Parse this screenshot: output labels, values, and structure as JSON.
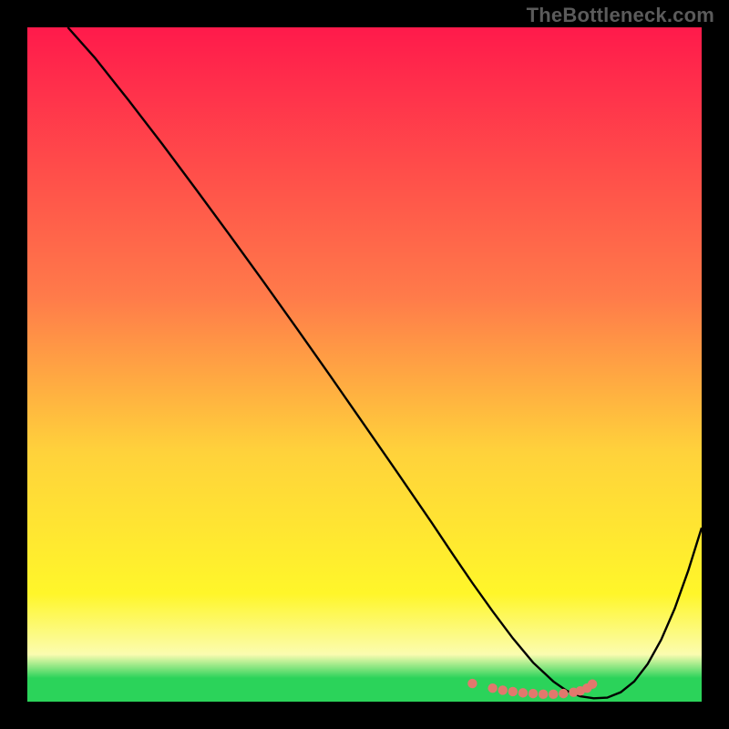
{
  "watermark": "TheBottleneck.com",
  "colors": {
    "bg": "#000000",
    "curve": "#000000",
    "marker": "#e2786d",
    "grad_top": "#ff1a4b",
    "grad_mid_upper": "#ff7b4a",
    "grad_mid": "#ffd23b",
    "grad_low": "#fff62a",
    "grad_yellow_pale": "#fbfcb0",
    "grad_green": "#2bd35a"
  },
  "chart_data": {
    "type": "line",
    "title": "",
    "xlabel": "",
    "ylabel": "",
    "xlim": [
      0,
      100
    ],
    "ylim": [
      0,
      100
    ],
    "curve": {
      "x": [
        6,
        10,
        15,
        20,
        25,
        30,
        35,
        40,
        45,
        50,
        55,
        60,
        63,
        66,
        69,
        72,
        75,
        78,
        80,
        82,
        84,
        86,
        88,
        90,
        92,
        94,
        96,
        98,
        100
      ],
      "y": [
        100,
        95.5,
        89.2,
        82.7,
        76.0,
        69.2,
        62.3,
        55.3,
        48.2,
        41.0,
        33.8,
        26.5,
        22.0,
        17.6,
        13.4,
        9.4,
        5.8,
        3.0,
        1.6,
        0.8,
        0.5,
        0.6,
        1.4,
        3.0,
        5.6,
        9.2,
        13.8,
        19.4,
        25.8
      ]
    },
    "markers": {
      "x": [
        66.0,
        69.0,
        70.5,
        72.0,
        73.5,
        75.0,
        76.5,
        78.0,
        79.5,
        81.0,
        82.0,
        83.0,
        83.8
      ],
      "y": [
        2.7,
        2.0,
        1.7,
        1.5,
        1.3,
        1.2,
        1.1,
        1.1,
        1.2,
        1.4,
        1.6,
        2.0,
        2.6
      ]
    },
    "gradient_stops": [
      {
        "offset": 0.0,
        "key": "grad_top"
      },
      {
        "offset": 0.4,
        "key": "grad_mid_upper"
      },
      {
        "offset": 0.63,
        "key": "grad_mid"
      },
      {
        "offset": 0.84,
        "key": "grad_low"
      },
      {
        "offset": 0.93,
        "key": "grad_yellow_pale"
      },
      {
        "offset": 0.965,
        "key": "grad_green"
      },
      {
        "offset": 1.0,
        "key": "grad_green"
      }
    ]
  }
}
